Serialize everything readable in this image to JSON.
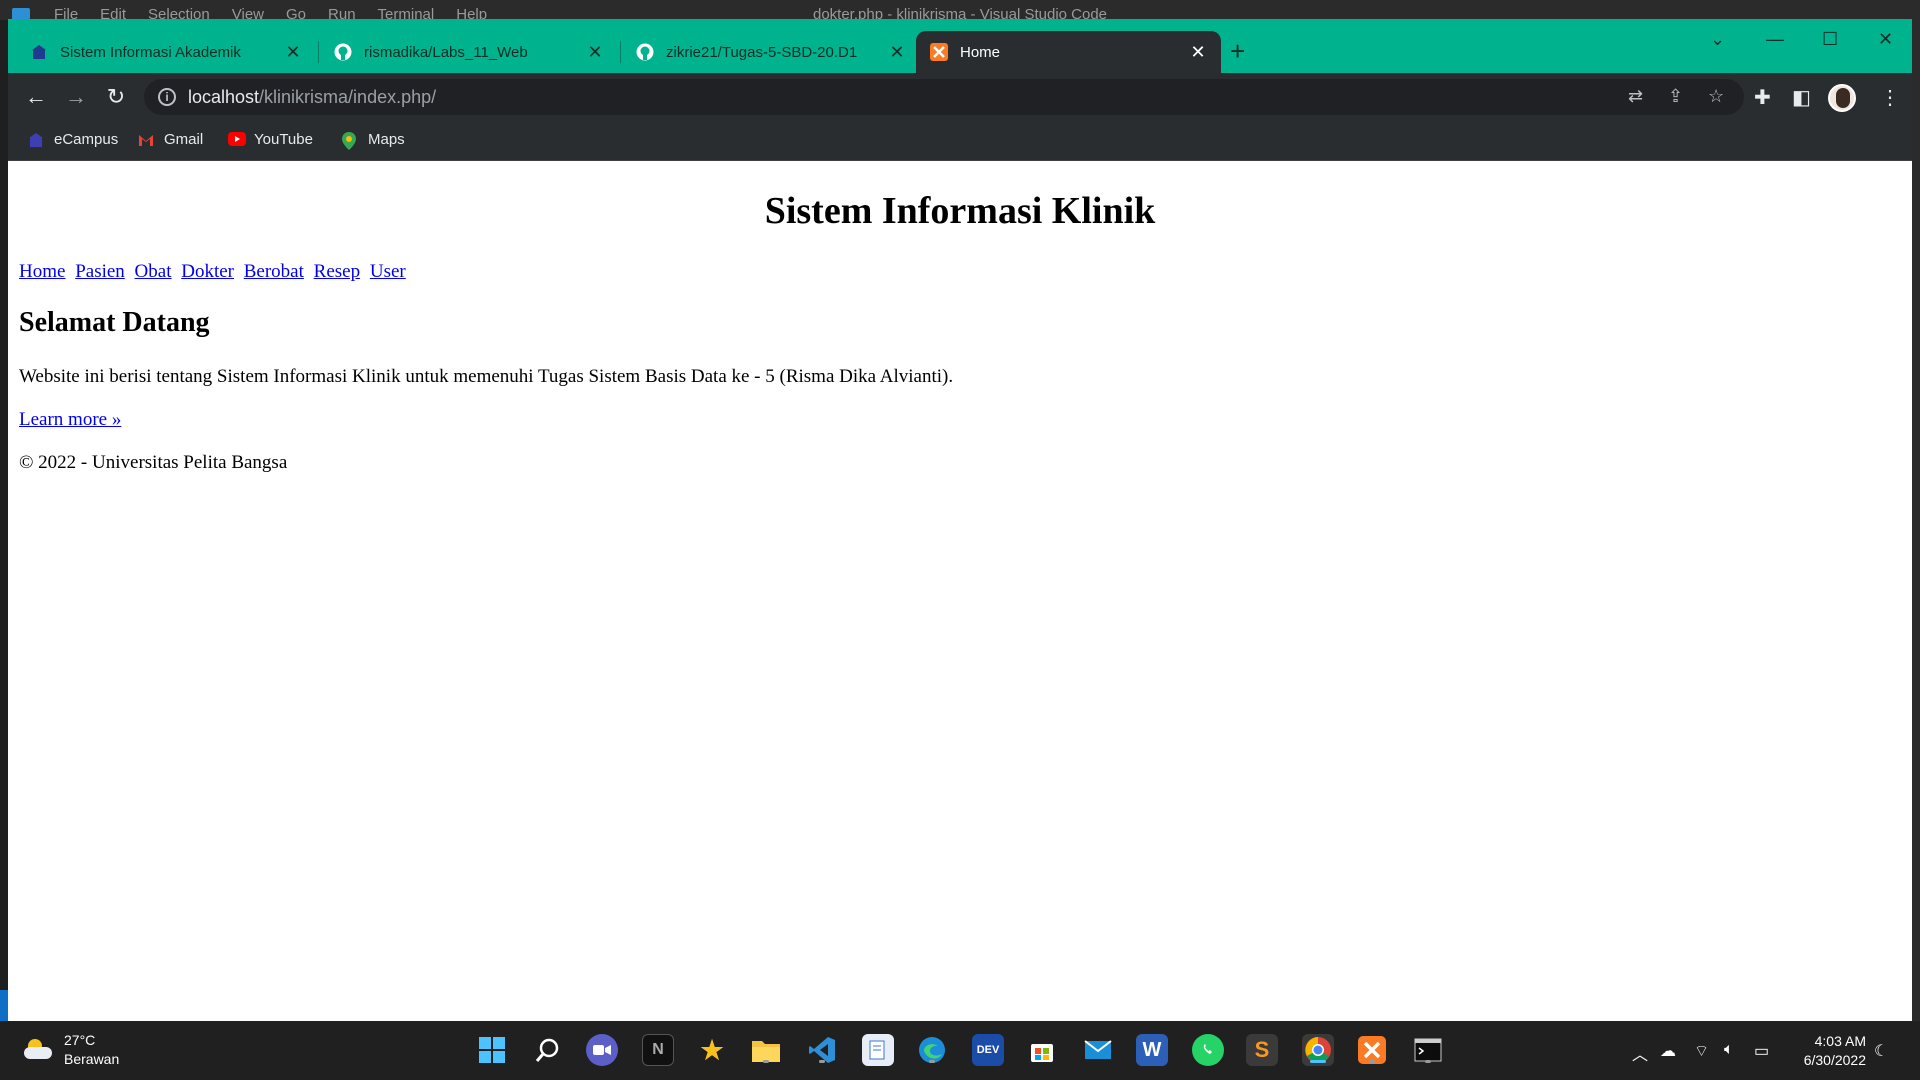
{
  "vscode": {
    "menu": [
      "File",
      "Edit",
      "Selection",
      "View",
      "Go",
      "Run",
      "Terminal",
      "Help"
    ],
    "title": "dokter.php - klinikrisma - Visual Studio Code"
  },
  "browser": {
    "tabs": [
      {
        "title": "Sistem Informasi Akademik",
        "icon": "campus-icon"
      },
      {
        "title": "rismadika/Labs_11_Web",
        "icon": "github-icon"
      },
      {
        "title": "zikrie21/Tugas-5-SBD-20.D1",
        "icon": "github-icon"
      },
      {
        "title": "Home",
        "icon": "xampp-icon",
        "active": true
      }
    ],
    "url_host": "localhost",
    "url_path": "/klinikrisma/index.php/",
    "bookmarks": [
      {
        "label": "eCampus",
        "icon": "ecampus-icon"
      },
      {
        "label": "Gmail",
        "icon": "gmail-icon"
      },
      {
        "label": "YouTube",
        "icon": "youtube-icon"
      },
      {
        "label": "Maps",
        "icon": "maps-icon"
      }
    ],
    "accent": "#00b38f"
  },
  "page": {
    "title": "Sistem Informasi Klinik",
    "nav": [
      "Home",
      "Pasien",
      "Obat",
      "Dokter",
      "Berobat",
      "Resep",
      "User"
    ],
    "heading": "Selamat Datang",
    "intro": "Website ini berisi tentang Sistem Informasi Klinik untuk memenuhi Tugas Sistem Basis Data ke - 5 (Risma Dika Alvianti).",
    "learn_more": "Learn more »",
    "footer": "© 2022 - Universitas Pelita Bangsa"
  },
  "taskbar": {
    "temp": "27°C",
    "condition": "Berawan",
    "time": "4:03 AM",
    "date": "6/30/2022",
    "apps": [
      "start-icon",
      "search-icon",
      "teams-icon",
      "notion-icon",
      "feedback-icon",
      "file-explorer-icon",
      "vscode-icon",
      "notepad-icon",
      "edge-icon",
      "dev-icon",
      "store-icon",
      "mail-icon",
      "word-icon",
      "whatsapp-icon",
      "sublime-icon",
      "chrome-icon",
      "xampp-icon",
      "terminal-icon"
    ]
  }
}
